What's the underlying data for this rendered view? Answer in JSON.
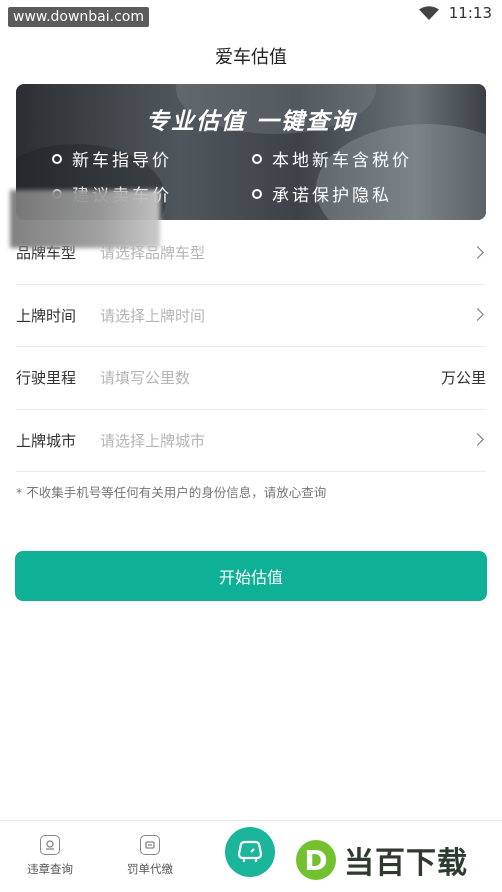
{
  "status_bar": {
    "watermark": "www.downbai.com",
    "time": "11:13",
    "wifi_icon": "wifi-icon"
  },
  "header": {
    "title": "爱车估值"
  },
  "banner": {
    "headline": "专业估值 一键查询",
    "features": [
      "新车指导价",
      "本地新车含税价",
      "建议卖车价",
      "承诺保护隐私"
    ]
  },
  "form": {
    "rows": [
      {
        "label": "品牌车型",
        "placeholder": "请选择品牌车型",
        "trailing": "chevron-right-icon"
      },
      {
        "label": "上牌时间",
        "placeholder": "请选择上牌时间",
        "trailing": "chevron-right-icon"
      },
      {
        "label": "行驶里程",
        "placeholder": "请填写公里数",
        "unit": "万公里"
      },
      {
        "label": "上牌城市",
        "placeholder": "请选择上牌城市",
        "trailing": "chevron-right-icon"
      }
    ]
  },
  "disclaimer": "* 不收集手机号等任何有关用户的身份信息，请放心查询",
  "primary_button": "开始估值",
  "tab_bar": {
    "items": [
      {
        "label": "违章查询",
        "icon": "violation-query-icon"
      },
      {
        "label": "罚单代缴",
        "icon": "fine-payment-icon"
      }
    ],
    "center_icon": "car-icon"
  },
  "logo_watermark": {
    "letter": "D",
    "text": "当百下载"
  },
  "colors": {
    "accent": "#0fb196",
    "placeholder": "#b5b5b5",
    "divider": "#ececec"
  }
}
